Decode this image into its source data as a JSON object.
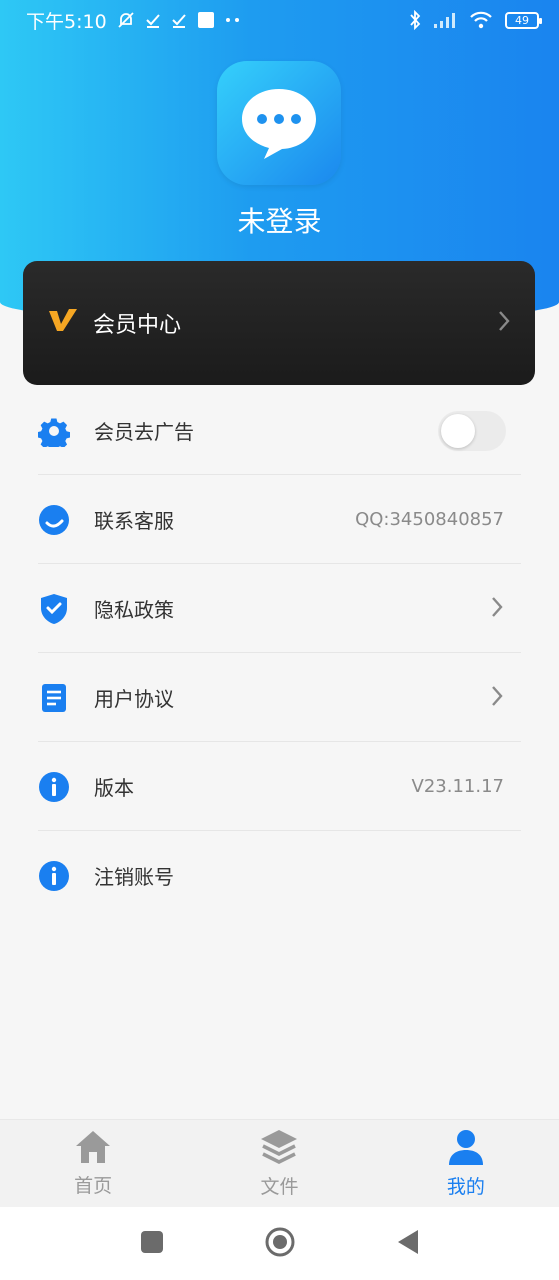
{
  "status_bar": {
    "time": "下午5:10",
    "battery": "49"
  },
  "profile": {
    "login_status": "未登录"
  },
  "vip_card": {
    "label": "会员中心"
  },
  "menu": {
    "items": [
      {
        "label": "会员去广告",
        "icon": "gear-icon",
        "control": "toggle",
        "toggle_on": false
      },
      {
        "label": "联系客服",
        "icon": "customer-service-icon",
        "value": "QQ:3450840857"
      },
      {
        "label": "隐私政策",
        "icon": "shield-icon",
        "control": "chevron"
      },
      {
        "label": "用户协议",
        "icon": "document-icon",
        "control": "chevron"
      },
      {
        "label": "版本",
        "icon": "info-icon",
        "value": "V23.11.17"
      },
      {
        "label": "注销账号",
        "icon": "info-icon"
      }
    ]
  },
  "tabbar": {
    "tabs": [
      {
        "label": "首页",
        "icon": "home-icon",
        "active": false
      },
      {
        "label": "文件",
        "icon": "layers-icon",
        "active": false
      },
      {
        "label": "我的",
        "icon": "user-icon",
        "active": true
      }
    ]
  },
  "colors": {
    "accent": "#1a7ff0",
    "gradient_start": "#2ec8f5",
    "gradient_end": "#1a84ef",
    "vip_gold": "#f5a623"
  }
}
